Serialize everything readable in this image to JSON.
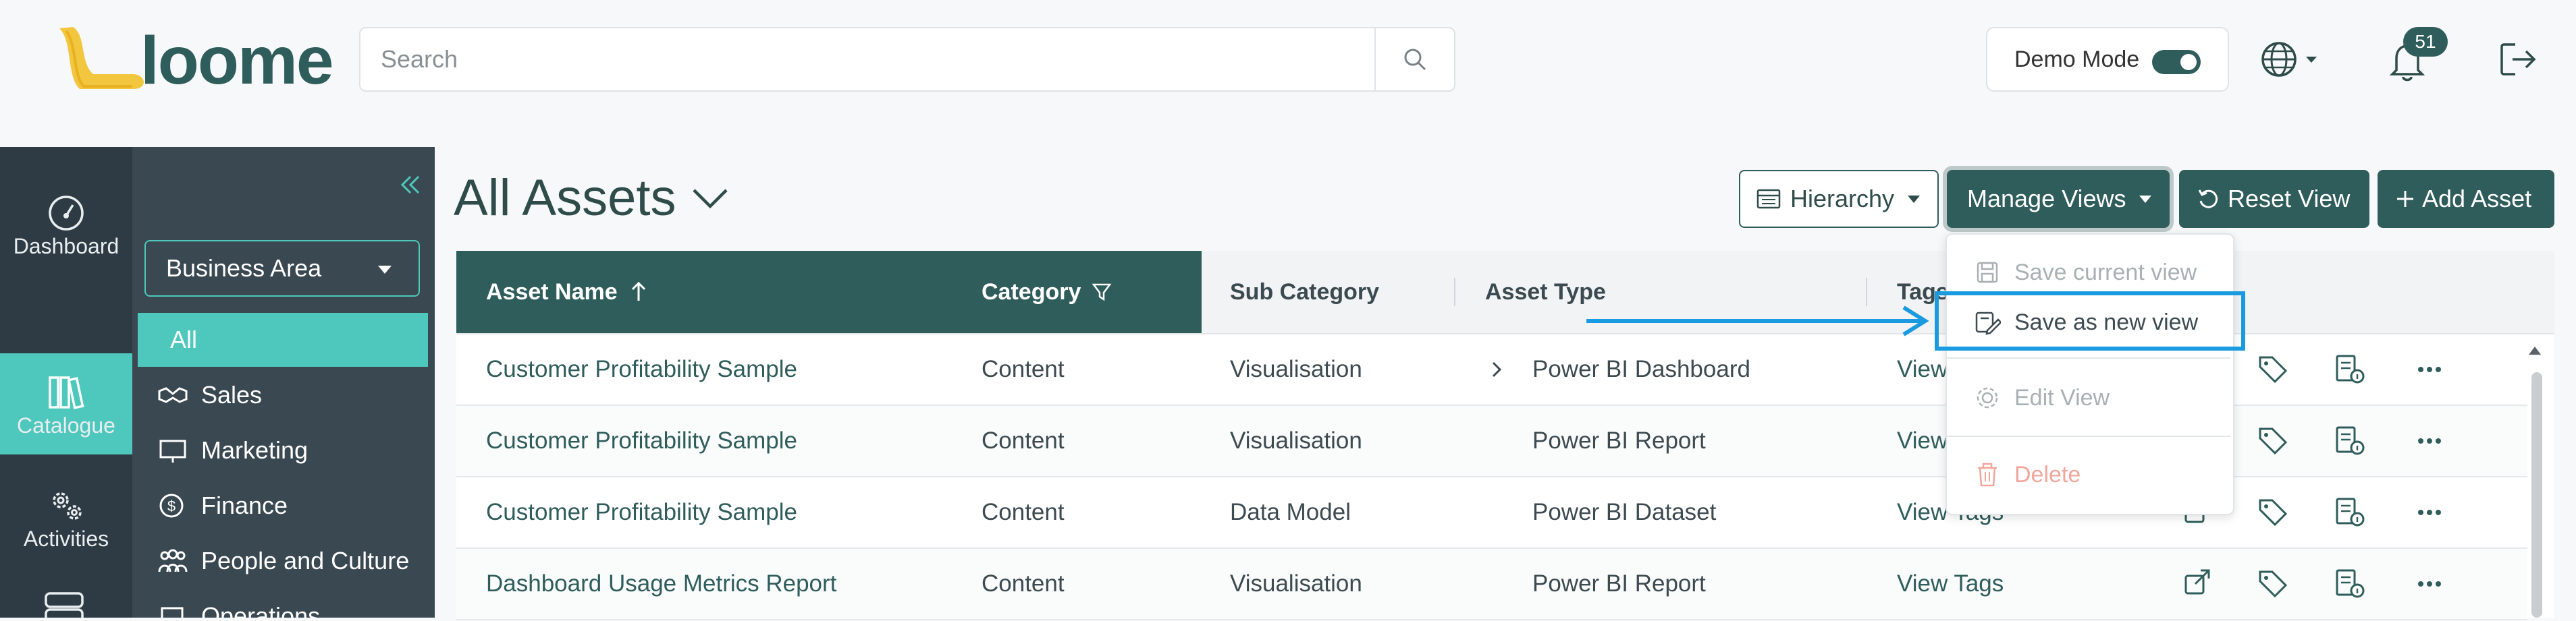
{
  "header": {
    "logo_text": "loome",
    "search_placeholder": "Search",
    "demo_mode_label": "Demo Mode",
    "notification_count": "51"
  },
  "rail": [
    {
      "label": "Dashboard",
      "icon": "dashboard-icon"
    },
    {
      "label": "Catalogue",
      "icon": "catalogue-icon",
      "active": true
    },
    {
      "label": "Activities",
      "icon": "activities-icon"
    }
  ],
  "panel": {
    "business_area_label": "Business Area",
    "items": [
      {
        "label": "All",
        "active": true
      },
      {
        "label": "Sales",
        "icon": "handshake-icon"
      },
      {
        "label": "Marketing",
        "icon": "presentation-icon"
      },
      {
        "label": "Finance",
        "icon": "dollar-icon"
      },
      {
        "label": "People and Culture",
        "icon": "people-icon"
      },
      {
        "label": "Operations",
        "icon": "operations-icon"
      }
    ]
  },
  "main": {
    "title": "All Assets",
    "buttons": {
      "hierarchy": "Hierarchy",
      "manage_views": "Manage Views",
      "reset_view": "Reset View",
      "add_asset": "Add Asset"
    }
  },
  "table": {
    "columns": [
      "Asset Name",
      "Category",
      "Sub Category",
      "Asset Type",
      "Tags"
    ],
    "rows": [
      {
        "name": "Customer Profitability Sample",
        "category": "Content",
        "sub_category": "Visualisation",
        "asset_type": "Power BI Dashboard",
        "tags": "View Tags"
      },
      {
        "name": "Customer Profitability Sample",
        "category": "Content",
        "sub_category": "Visualisation",
        "asset_type": "Power BI Report",
        "tags": "View Tags"
      },
      {
        "name": "Customer Profitability Sample",
        "category": "Content",
        "sub_category": "Data Model",
        "asset_type": "Power BI Dataset",
        "tags": "View Tags"
      },
      {
        "name": "Dashboard Usage Metrics Report",
        "category": "Content",
        "sub_category": "Visualisation",
        "asset_type": "Power BI Report",
        "tags": "View Tags"
      }
    ]
  },
  "manage_views_menu": {
    "items": [
      {
        "label": "Save current view",
        "state": "disabled"
      },
      {
        "label": "Save as new view",
        "state": "enabled"
      },
      {
        "label": "Edit View",
        "state": "disabled"
      },
      {
        "label": "Delete",
        "state": "danger-disabled"
      }
    ]
  },
  "colors": {
    "brand": "#2f5d5b",
    "accent": "#4ec7bc",
    "sidebar": "#2f3b44",
    "highlight": "#1a9be0"
  }
}
